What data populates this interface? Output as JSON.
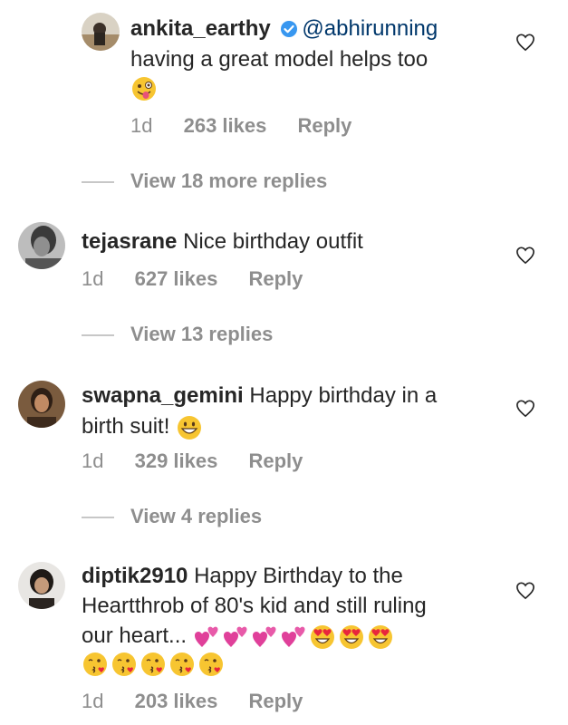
{
  "comments": [
    {
      "username": "ankita_earthy",
      "mention": "@abhirunning",
      "text_line1": "having a great model helps too",
      "time": "1d",
      "likes": "263 likes",
      "reply": "Reply",
      "verified": true,
      "emojis": [
        "winking-tongue-face"
      ]
    },
    {
      "username": "tejasrane",
      "text": "Nice birthday outfit",
      "time": "1d",
      "likes": "627 likes",
      "reply": "Reply"
    },
    {
      "username": "swapna_gemini",
      "text_line1": "Happy birthday in a",
      "text_line2": "birth suit!",
      "time": "1d",
      "likes": "329 likes",
      "reply": "Reply",
      "emojis": [
        "grinning-face"
      ]
    },
    {
      "username": "diptik2910",
      "text_line1": "Happy Birthday to the",
      "text_line2": "Heartthrob of 80's kid and still ruling",
      "text_line3": "our heart...",
      "time": "1d",
      "likes": "203 likes",
      "reply": "Reply",
      "emojis_line3": [
        "two-hearts",
        "two-hearts",
        "two-hearts",
        "two-hearts",
        "heart-eyes",
        "heart-eyes",
        "heart-eyes"
      ],
      "emojis_line4": [
        "kissing-face",
        "kissing-face",
        "kissing-face",
        "kissing-face",
        "kissing-face"
      ]
    }
  ],
  "view_replies": [
    "View 18 more replies",
    "View 13 replies",
    "View 4 replies"
  ],
  "colors": {
    "text": "#262626",
    "secondary": "#8e8e8e",
    "mention": "#00376b",
    "verified": "#3897f0"
  }
}
